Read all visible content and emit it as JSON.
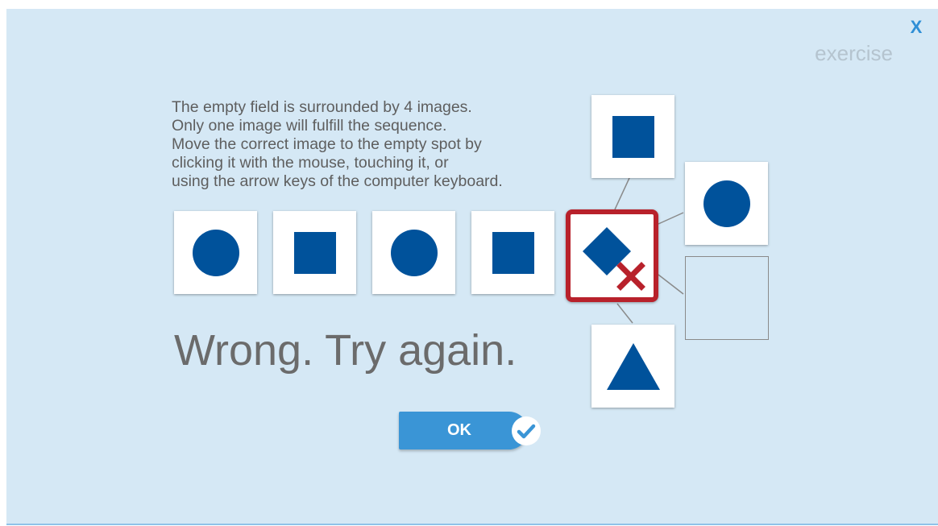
{
  "header": {
    "close_label": "X",
    "mode_label": "exercise"
  },
  "instructions": [
    "The empty field is surrounded by 4 images.",
    "Only one image will fulfill the sequence.",
    "Move the correct image to the empty spot by",
    "clicking it with the mouse, touching it, or",
    "using the arrow keys of the computer keyboard."
  ],
  "sequence": [
    "circle",
    "square",
    "circle",
    "square"
  ],
  "choices": {
    "top": "square",
    "right": "circle",
    "bottom": "triangle",
    "selected": "diamond",
    "selected_status": "wrong",
    "empty_slot": "empty"
  },
  "feedback": {
    "message": "Wrong. Try again."
  },
  "ok_button": {
    "label": "OK",
    "icon": "checkmark-icon"
  },
  "colors": {
    "background": "#d5e8f5",
    "shape": "#00529b",
    "wrong_border": "#b8212b",
    "accent": "#3a95d6",
    "close": "#2f8fd6"
  }
}
